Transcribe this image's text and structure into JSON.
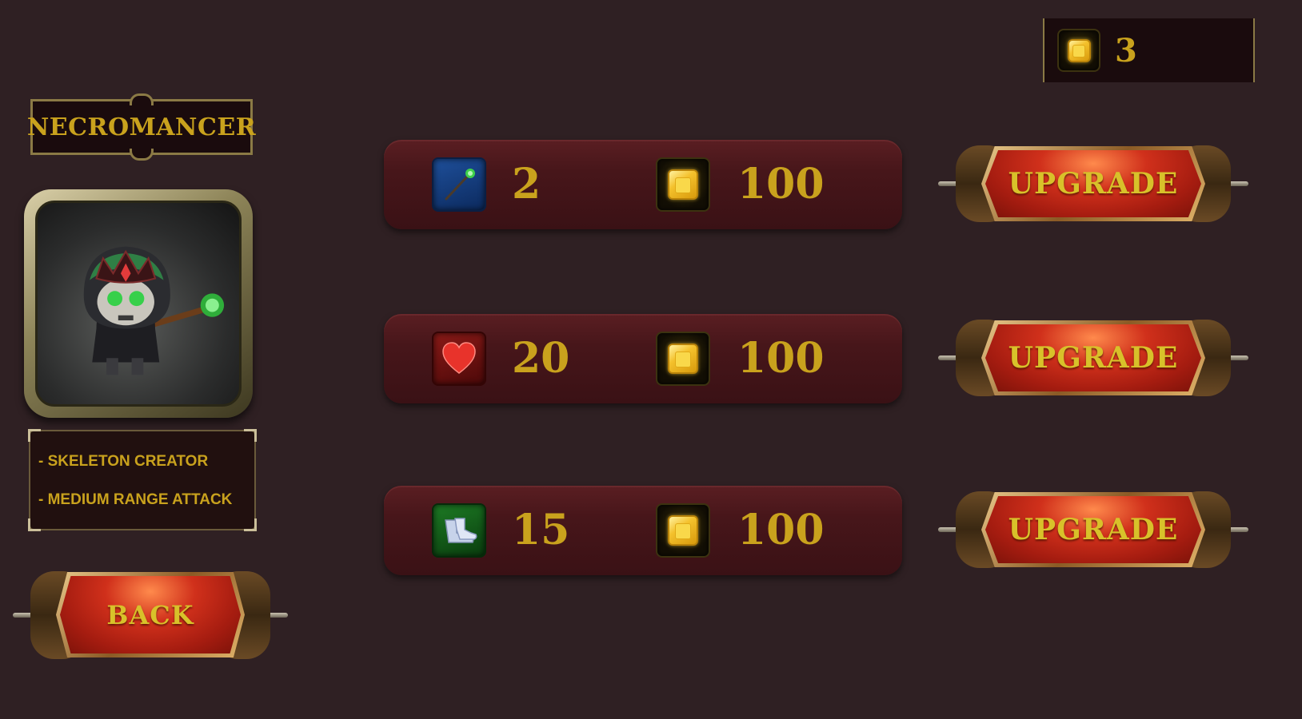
{
  "currency": {
    "amount": "3",
    "icon": "gold-coin-icon"
  },
  "hero": {
    "class_name": "NECROMANCER",
    "traits": [
      "- SKELETON CREATOR",
      "- MEDIUM RANGE ATTACK"
    ]
  },
  "stats": [
    {
      "stat": "attack",
      "icon": "staff-icon",
      "value": "2",
      "cost": "100",
      "upgrade_label": "UPGRADE"
    },
    {
      "stat": "health",
      "icon": "heart-icon",
      "value": "20",
      "cost": "100",
      "upgrade_label": "UPGRADE"
    },
    {
      "stat": "speed",
      "icon": "boot-icon",
      "value": "15",
      "cost": "100",
      "upgrade_label": "UPGRADE"
    }
  ],
  "back_label": "BACK",
  "colors": {
    "background": "#2f2023",
    "text_gold": "#c9a21d",
    "button_red": "#a51c10",
    "row_red": "#47161a"
  }
}
